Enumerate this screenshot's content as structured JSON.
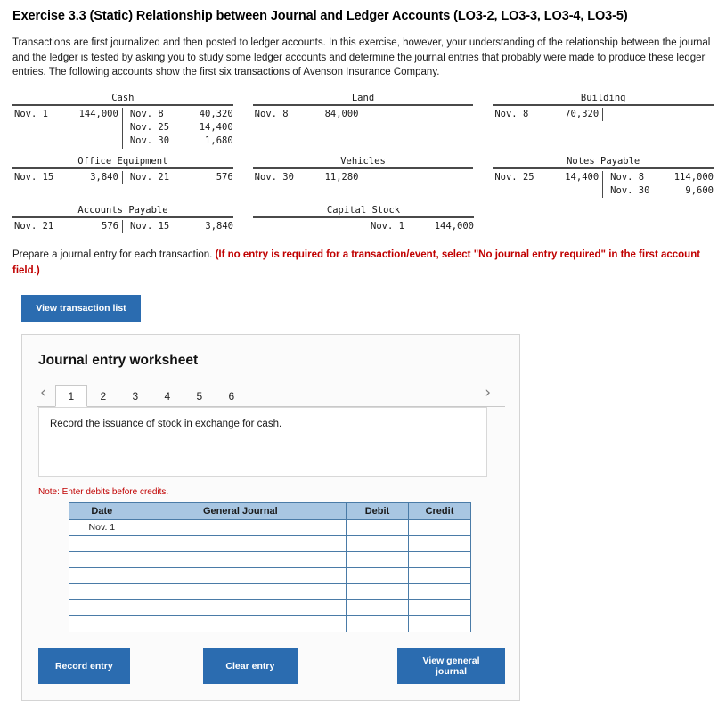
{
  "title": "Exercise 3.3 (Static) Relationship between Journal and Ledger Accounts (LO3-2, LO3-3, LO3-4, LO3-5)",
  "intro": "Transactions are first journalized and then posted to ledger accounts. In this exercise, however, your understanding of the relationship between the journal and the ledger is tested by asking you to study some ledger accounts and determine the journal entries that probably were made to produce these ledger entries. The following accounts show the first six transactions of Avenson Insurance Company.",
  "ledger": {
    "row1": [
      {
        "name": "Cash",
        "debits": [
          {
            "date": "Nov. 1",
            "amount": "144,000"
          }
        ],
        "credits": [
          {
            "date": "Nov. 8",
            "amount": "40,320"
          },
          {
            "date": "Nov. 25",
            "amount": "14,400"
          },
          {
            "date": "Nov. 30",
            "amount": "1,680"
          }
        ]
      },
      {
        "name": "Land",
        "debits": [
          {
            "date": "Nov. 8",
            "amount": "84,000"
          }
        ],
        "credits": []
      },
      {
        "name": "Building",
        "debits": [
          {
            "date": "Nov. 8",
            "amount": "70,320"
          }
        ],
        "credits": []
      }
    ],
    "row2": [
      {
        "name": "Office Equipment",
        "debits": [
          {
            "date": "Nov. 15",
            "amount": "3,840"
          }
        ],
        "credits": [
          {
            "date": "Nov. 21",
            "amount": "576"
          }
        ]
      },
      {
        "name": "Vehicles",
        "debits": [
          {
            "date": "Nov. 30",
            "amount": "11,280"
          }
        ],
        "credits": []
      },
      {
        "name": "Notes Payable",
        "debits": [
          {
            "date": "Nov. 25",
            "amount": "14,400"
          }
        ],
        "credits": [
          {
            "date": "Nov. 8",
            "amount": "114,000"
          },
          {
            "date": "Nov. 30",
            "amount": "9,600"
          }
        ]
      }
    ],
    "row3": [
      {
        "name": "Accounts Payable",
        "debits": [
          {
            "date": "Nov. 21",
            "amount": "576"
          }
        ],
        "credits": [
          {
            "date": "Nov. 15",
            "amount": "3,840"
          }
        ]
      },
      {
        "name": "Capital Stock",
        "debits": [],
        "credits": [
          {
            "date": "Nov. 1",
            "amount": "144,000"
          }
        ]
      }
    ]
  },
  "prepare": {
    "lead": "Prepare a journal entry for each transaction. ",
    "bold_red": "(If no entry is required for a transaction/event, select \"No journal entry required\" in the first account field.)"
  },
  "buttons": {
    "view_transaction_list": "View transaction list",
    "record_entry": "Record entry",
    "clear_entry": "Clear entry",
    "view_general_journal": "View general journal"
  },
  "worksheet": {
    "heading": "Journal entry worksheet",
    "prev_arrow": "‹",
    "next_arrow": "›",
    "tabs": [
      {
        "label": "1",
        "active": true
      },
      {
        "label": "2",
        "active": false
      },
      {
        "label": "3",
        "active": false
      },
      {
        "label": "4",
        "active": false
      },
      {
        "label": "5",
        "active": false
      },
      {
        "label": "6",
        "active": false
      }
    ],
    "prompt": "Record the issuance of stock in exchange for cash.",
    "note": "Note: Enter debits before credits.",
    "table": {
      "headers": [
        "Date",
        "General Journal",
        "Debit",
        "Credit"
      ],
      "rows": [
        {
          "date": "Nov. 1",
          "account": "",
          "debit": "",
          "credit": ""
        },
        {
          "date": "",
          "account": "",
          "debit": "",
          "credit": ""
        },
        {
          "date": "",
          "account": "",
          "debit": "",
          "credit": ""
        },
        {
          "date": "",
          "account": "",
          "debit": "",
          "credit": ""
        },
        {
          "date": "",
          "account": "",
          "debit": "",
          "credit": ""
        },
        {
          "date": "",
          "account": "",
          "debit": "",
          "credit": ""
        },
        {
          "date": "",
          "account": "",
          "debit": "",
          "credit": ""
        }
      ]
    }
  },
  "colors": {
    "accent": "#2b6cb0",
    "table_header": "#a8c6e2",
    "red": "#c00000"
  }
}
